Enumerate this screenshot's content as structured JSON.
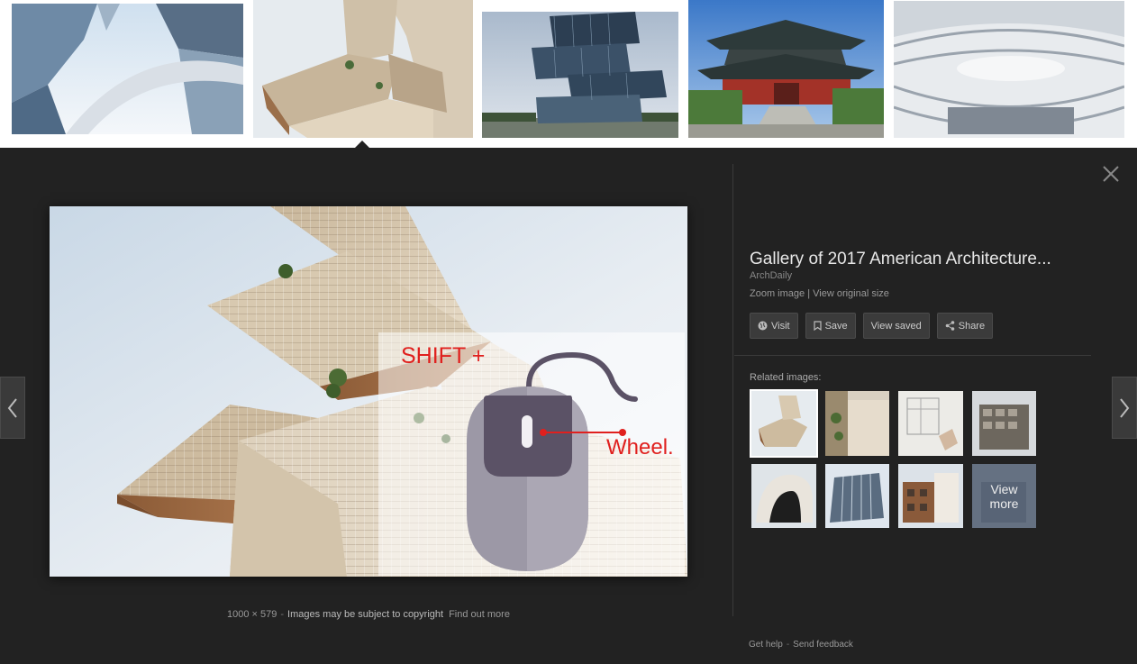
{
  "strip": {
    "thumbs": [
      {
        "name": "glass-skyscrapers"
      },
      {
        "name": "stacked-tower"
      },
      {
        "name": "glass-stacked-building"
      },
      {
        "name": "chinese-temple"
      },
      {
        "name": "curved-atrium"
      }
    ]
  },
  "viewer": {
    "title": "Gallery of 2017 American Architecture...",
    "source": "ArchDaily",
    "zoom_link": "Zoom image",
    "size_separator": "|",
    "original_link": "View original size",
    "buttons": {
      "visit": "Visit",
      "save": "Save",
      "view_saved": "View saved",
      "share": "Share"
    },
    "related_label": "Related images:",
    "view_more_line1": "View",
    "view_more_line2": "more",
    "dimensions": "1000 × 579",
    "dash": "-",
    "copyright": "Images may be subject to copyright",
    "find_out_more": "Find out more",
    "footer": {
      "help": "Get help",
      "dash": "-",
      "feedback": "Send feedback"
    }
  },
  "overlay": {
    "shift_text": "SHIFT +",
    "wheel_text": "Wheel."
  },
  "colors": {
    "background": "#222222",
    "overlay_red": "#e0201e",
    "mouse_body": "#9c98a6",
    "mouse_button": "#5b5266"
  }
}
